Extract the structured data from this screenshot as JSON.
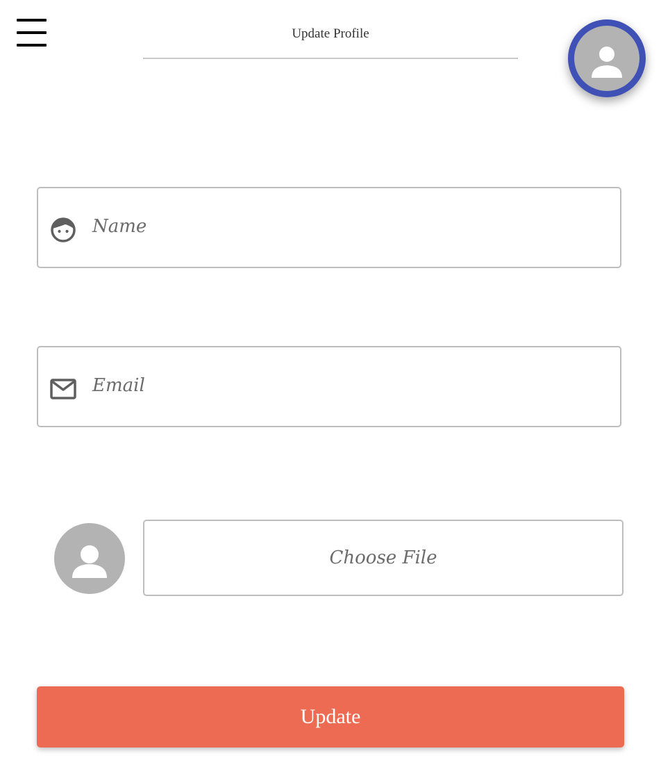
{
  "header": {
    "title": "Update Profile",
    "menu_icon": "hamburger-menu-icon",
    "avatar_icon": "user-avatar-icon"
  },
  "form": {
    "name_field": {
      "placeholder": "Name",
      "value": "",
      "icon": "face-icon"
    },
    "email_field": {
      "placeholder": "Email",
      "value": "",
      "icon": "mail-icon"
    },
    "file_picker": {
      "label": "Choose File",
      "preview_icon": "user-avatar-icon"
    },
    "submit_label": "Update"
  },
  "colors": {
    "accent": "#ed6b53",
    "avatar_ring": "#3f51b5",
    "avatar_fill": "#b3b3b3",
    "border": "#bdbdbd",
    "placeholder_text": "#6b6b6b"
  }
}
